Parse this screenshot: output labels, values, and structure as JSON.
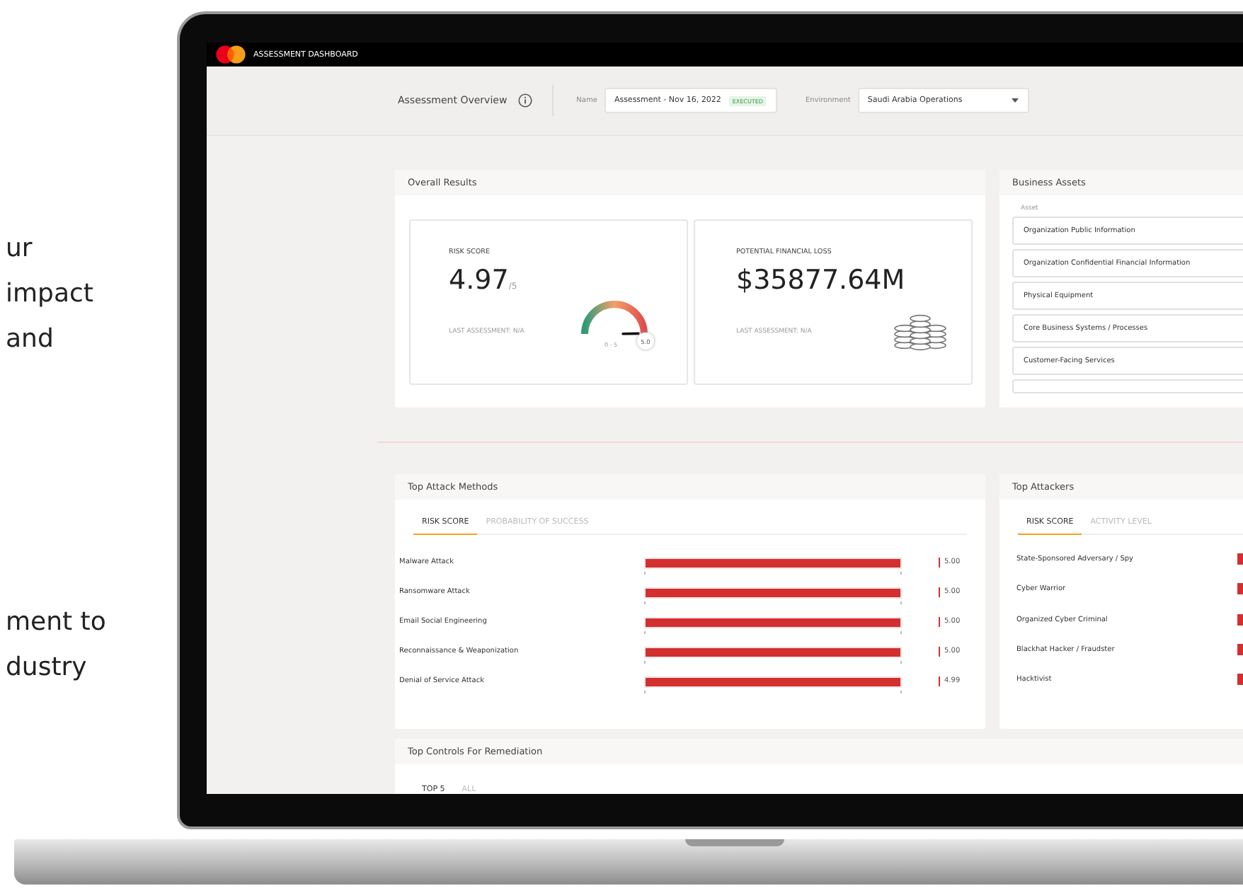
{
  "left_copy": [
    {
      "lines": [
        "ur",
        "impact",
        "and"
      ]
    },
    {
      "lines": [
        "ment to",
        "dustry"
      ]
    }
  ],
  "app": {
    "title": "ASSESSMENT DASHBOARD"
  },
  "overview": {
    "title": "Assessment Overview",
    "name_label": "Name",
    "name_value": "Assessment - Nov 16, 2022",
    "status": "EXECUTED",
    "environment_label": "Environment",
    "environment_value": "Saudi Arabia Operations"
  },
  "overall_results": {
    "title": "Overall Results",
    "risk_score": {
      "label": "RISK SCORE",
      "value": "4.97",
      "suffix": "/5",
      "last": "LAST ASSESSMENT: N/A",
      "gauge": {
        "range": "0 - 5",
        "reading": "5.0",
        "level": 0.994
      }
    },
    "financial_loss": {
      "label": "POTENTIAL FINANCIAL LOSS",
      "value": "$35877.64M",
      "last": "LAST ASSESSMENT: N/A"
    }
  },
  "business_assets": {
    "title": "Business Assets",
    "column": "Asset",
    "items": [
      "Organization Public Information",
      "Organization Confidential Financial Information",
      "Physical Equipment",
      "Core Business Systems / Processes",
      "Customer-Facing Services"
    ]
  },
  "top_attack_methods": {
    "title": "Top Attack Methods",
    "tabs": [
      {
        "label": "RISK SCORE",
        "selected": true
      },
      {
        "label": "PROBABILITY OF SUCCESS",
        "selected": false
      }
    ],
    "rows": [
      {
        "name": "Malware Attack",
        "level": 1,
        "reading": "5.00"
      },
      {
        "name": "Ransomware Attack",
        "level": 1,
        "reading": "5.00"
      },
      {
        "name": "Email Social Engineering",
        "level": 1,
        "reading": "5.00"
      },
      {
        "name": "Reconnaissance & Weaponization",
        "level": 1,
        "reading": "5.00"
      },
      {
        "name": "Denial of Service Attack",
        "level": 0.998,
        "reading": "4.99"
      }
    ]
  },
  "top_attackers": {
    "title": "Top Attackers",
    "tabs": [
      {
        "label": "RISK SCORE",
        "selected": true
      },
      {
        "label": "ACTIVITY LEVEL",
        "selected": false
      }
    ],
    "items": [
      "State-Sponsored Adversary / Spy",
      "Cyber Warrior",
      "Organized Cyber Criminal",
      "Blackhat Hacker / Fraudster",
      "Hacktivist"
    ]
  },
  "top_controls": {
    "title": "Top Controls For Remediation",
    "tabs": [
      {
        "label": "TOP 5",
        "selected": true
      },
      {
        "label": "ALL",
        "selected": false
      }
    ]
  }
}
